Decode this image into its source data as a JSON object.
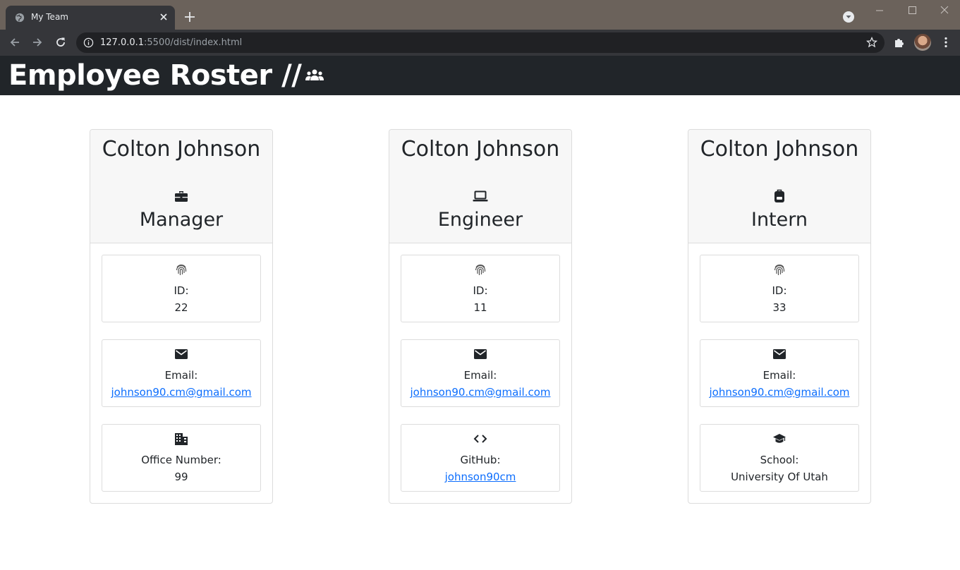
{
  "browser": {
    "tab_title": "My Team",
    "url_host": "127.0.0.1",
    "url_rest": ":5500/dist/index.html"
  },
  "header": {
    "title": "Employee Roster //",
    "icon": "users-icon"
  },
  "colors": {
    "header_bg": "#212529",
    "card_head_bg": "#f7f7f7",
    "link": "#0d6efd"
  },
  "cards": [
    {
      "name": "Colton Johnson",
      "role": "Manager",
      "role_icon": "briefcase-icon",
      "rows": [
        {
          "icon": "fingerprint-icon",
          "label": "ID:",
          "value": "22"
        },
        {
          "icon": "envelope-icon",
          "label": "Email:",
          "value": "johnson90.cm@gmail.com"
        },
        {
          "icon": "building-icon",
          "label": "Office Number:",
          "value": "99"
        }
      ]
    },
    {
      "name": "Colton Johnson",
      "role": "Engineer",
      "role_icon": "laptop-icon",
      "rows": [
        {
          "icon": "fingerprint-icon",
          "label": "ID:",
          "value": "11"
        },
        {
          "icon": "envelope-icon",
          "label": "Email:",
          "value": "johnson90.cm@gmail.com"
        },
        {
          "icon": "code-icon",
          "label": "GitHub:",
          "value": "johnson90cm"
        }
      ]
    },
    {
      "name": "Colton Johnson",
      "role": "Intern",
      "role_icon": "backpack-icon",
      "rows": [
        {
          "icon": "fingerprint-icon",
          "label": "ID:",
          "value": "33"
        },
        {
          "icon": "envelope-icon",
          "label": "Email:",
          "value": "johnson90.cm@gmail.com"
        },
        {
          "icon": "graduation-cap-icon",
          "label": "School:",
          "value": "University Of Utah"
        }
      ]
    }
  ]
}
